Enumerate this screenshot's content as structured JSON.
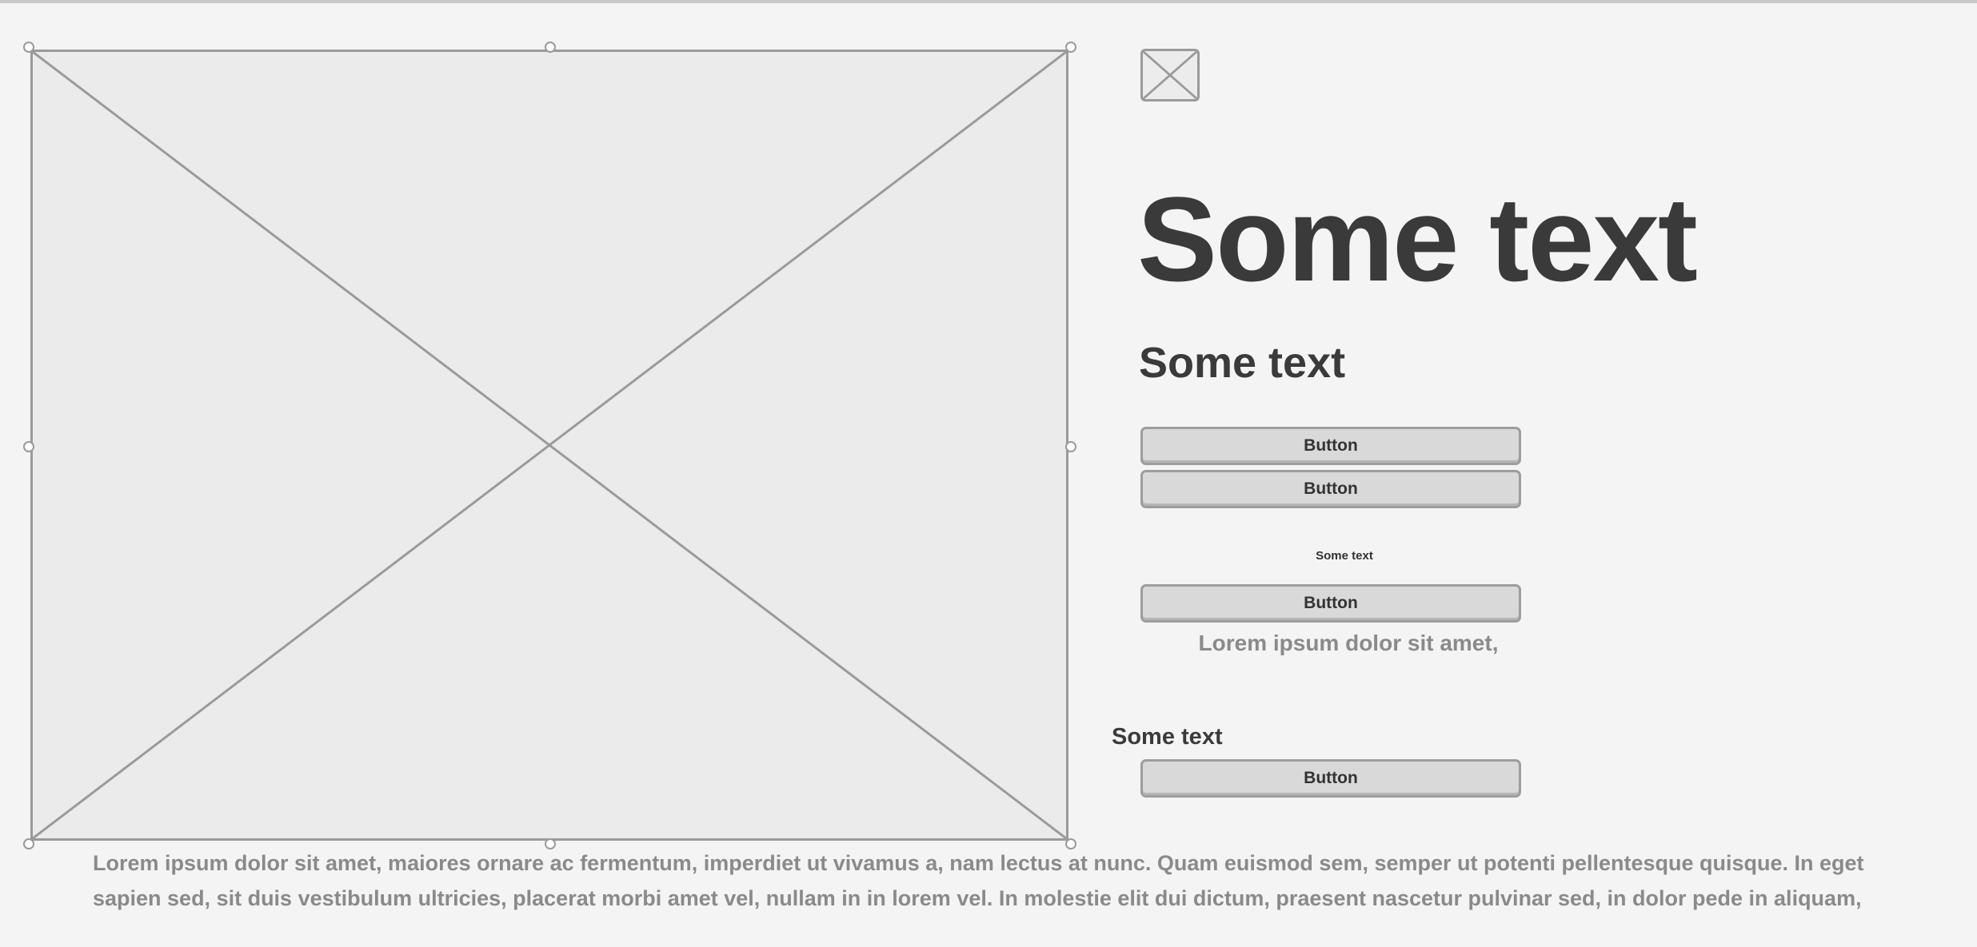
{
  "headings": {
    "large": "Some text",
    "medium": "Some text"
  },
  "buttons": {
    "button_1": "Button",
    "button_2": "Button",
    "button_3": "Button",
    "button_4": "Button"
  },
  "captions": {
    "small": "Some text",
    "lorem_short": "Lorem ipsum dolor sit amet,",
    "label": "Some text"
  },
  "paragraph": {
    "text": "Lorem ipsum dolor sit amet, maiores ornare ac fermentum, imperdiet ut vivamus a, nam lectus at nunc. Quam euismod sem, semper ut potenti pellentesque quisque. In eget sapien sed, sit duis vestibulum ultricies, placerat morbi amet vel, nullam in in lorem vel. In molestie elit dui dictum, praesent nascetur pulvinar sed, in dolor pede in aliquam,"
  },
  "icons": {
    "large_image": "image-placeholder-icon",
    "small_image": "image-placeholder-icon"
  },
  "colors": {
    "background": "#f4f4f4",
    "placeholder_fill": "#ebebeb",
    "placeholder_stroke": "#9a9a9a",
    "button_fill": "#d9d9d9",
    "text_dark": "#3a3a3a",
    "text_muted": "#8a8a8a"
  }
}
